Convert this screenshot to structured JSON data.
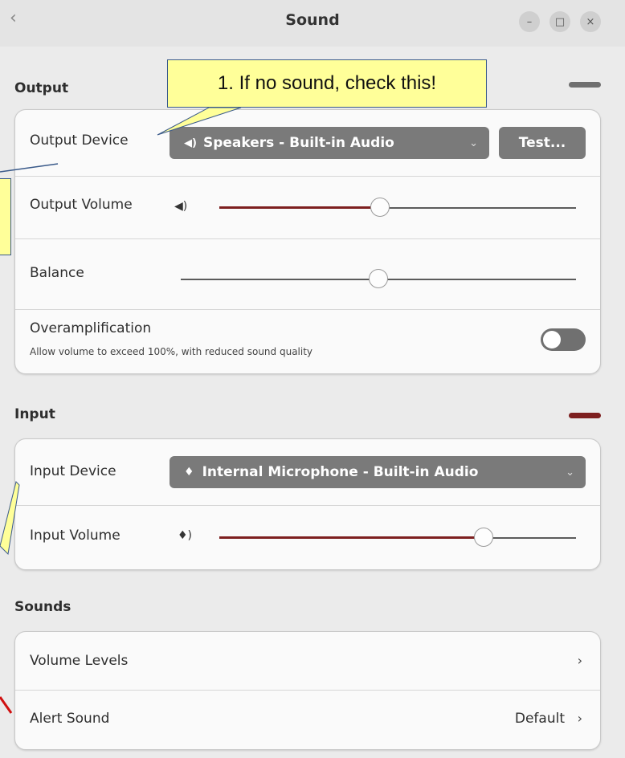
{
  "header": {
    "back_icon": "chevron-left-icon",
    "title": "Sound",
    "controls": {
      "minimize": "–",
      "maximize": "□",
      "close": "×"
    }
  },
  "callout": {
    "text": "1. If no sound, check this!"
  },
  "output": {
    "section_title": "Output",
    "device_label": "Output Device",
    "device_value": "Speakers - Built-in Audio",
    "test_label": "Test...",
    "volume_label": "Output Volume",
    "volume_level": 0.45,
    "balance_label": "Balance",
    "balance_level": 0.5,
    "overamp_label": "Overamplification",
    "overamp_desc": "Allow volume to exceed 100%, with reduced sound quality",
    "overamp_enabled": false
  },
  "input": {
    "section_title": "Input",
    "device_label": "Input Device",
    "device_value": "Internal Microphone - Built-in Audio",
    "volume_label": "Input Volume",
    "volume_level": 0.74
  },
  "sounds": {
    "section_title": "Sounds",
    "volume_levels_label": "Volume Levels",
    "alert_sound_label": "Alert Sound",
    "alert_sound_value": "Default"
  },
  "colors": {
    "accent_level": "#7d1f1f",
    "callout_fill": "#ffff99",
    "callout_border": "#3a5a8a"
  }
}
